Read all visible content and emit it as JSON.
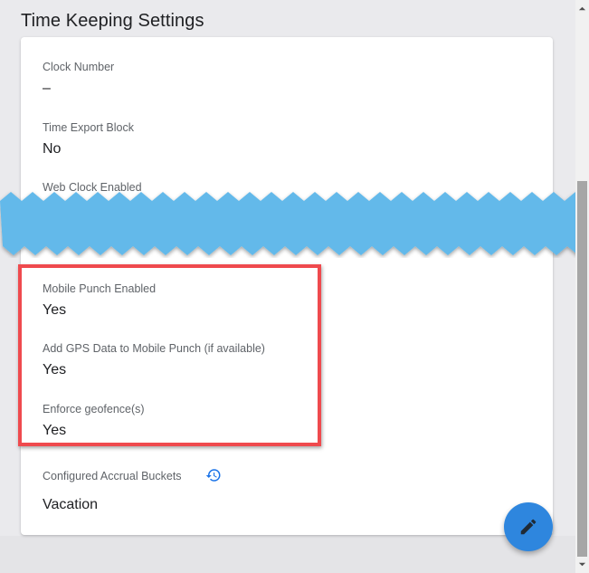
{
  "section": {
    "title": "Time Keeping Settings"
  },
  "fields": {
    "clock_number": {
      "label": "Clock Number",
      "value": "–"
    },
    "time_export_block": {
      "label": "Time Export Block",
      "value": "No"
    },
    "web_clock_enabled": {
      "label": "Web Clock Enabled"
    },
    "mobile_punch_enabled": {
      "label": "Mobile Punch Enabled",
      "value": "Yes"
    },
    "add_gps_data": {
      "label": "Add GPS Data to Mobile Punch (if available)",
      "value": "Yes"
    },
    "enforce_geofences": {
      "label": "Enforce geofence(s)",
      "value": "Yes"
    },
    "accrual_buckets": {
      "label": "Configured Accrual Buckets",
      "value": "Vacation"
    }
  },
  "icons": {
    "history": "history-icon",
    "edit": "pencil-icon"
  },
  "colors": {
    "highlight": "#ef4a4e",
    "torn_band": "#64b9ea",
    "fab": "#2e86de",
    "history_icon": "#1a73e8"
  }
}
